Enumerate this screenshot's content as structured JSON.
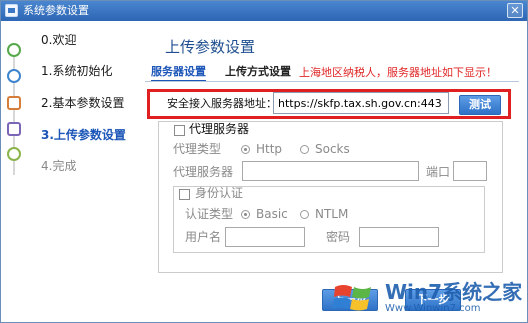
{
  "window": {
    "title": "系统参数设置",
    "close_glyph": "✕"
  },
  "sidebar": {
    "steps": [
      {
        "label": "0.欢迎",
        "state": "done"
      },
      {
        "label": "1.系统初始化",
        "state": "done"
      },
      {
        "label": "2.基本参数设置",
        "state": "done"
      },
      {
        "label": "3.上传参数设置",
        "state": "current"
      },
      {
        "label": "4.完成",
        "state": "pending"
      }
    ]
  },
  "main": {
    "page_title": "上传参数设置",
    "tabs": [
      {
        "label": "服务器设置",
        "active": true
      },
      {
        "label": "上传方式设置",
        "active": false
      }
    ],
    "notice": "上海地区纳税人，服务器地址如下显示！",
    "server": {
      "label": "安全接入服务器地址：",
      "value": "https://skfp.tax.sh.gov.cn:443",
      "test_button": "测试"
    },
    "proxy": {
      "checkbox_label": "代理服务器",
      "checked": false,
      "type_label": "代理类型",
      "options": [
        {
          "label": "Http",
          "selected": true
        },
        {
          "label": "Socks",
          "selected": false
        }
      ],
      "server_label": "代理服务器",
      "server_value": "",
      "port_label": "端口",
      "port_value": ""
    },
    "auth": {
      "checkbox_label": "身份认证",
      "checked": false,
      "type_label": "认证类型",
      "options": [
        {
          "label": "Basic",
          "selected": true
        },
        {
          "label": "NTLM",
          "selected": false
        }
      ],
      "username_label": "用户名",
      "username_value": "",
      "password_label": "密码",
      "password_value": ""
    },
    "nav": {
      "prev_label": "上一步",
      "next_label": "下一步"
    }
  },
  "watermark": {
    "brand": "Win7系统之家",
    "url": "Www.Winwin7.com"
  },
  "colors": {
    "accent": "#1c56b8",
    "notice": "#e02626",
    "highlight_border": "#e02020",
    "button": "#2e72c7"
  }
}
